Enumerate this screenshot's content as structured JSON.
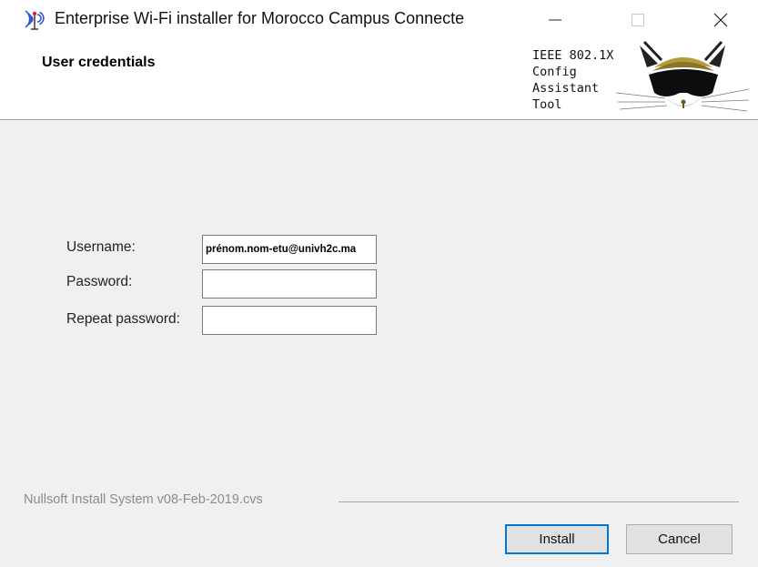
{
  "window": {
    "title": "Enterprise Wi-Fi installer for Morocco Campus Connecte",
    "controls": {
      "minimize": "minimize-icon",
      "maximize": "maximize-icon",
      "close": "close-icon"
    }
  },
  "header": {
    "title": "User credentials",
    "tool_lines": [
      "IEEE 802.1X",
      "Config",
      "Assistant",
      "Tool"
    ],
    "logo_icon": "cat-logo-icon"
  },
  "form": {
    "username": {
      "label": "Username:",
      "value": "prénom.nom-etu@univh2c.ma"
    },
    "password": {
      "label": "Password:",
      "value": ""
    },
    "repeat_password": {
      "label": "Repeat password:",
      "value": ""
    }
  },
  "footer": {
    "branding": "Nullsoft Install System v08-Feb-2019.cvs"
  },
  "buttons": {
    "install": "Install",
    "cancel": "Cancel"
  },
  "colors": {
    "content_bg": "#f0f0f0",
    "focus_border": "#0078d7",
    "button_bg": "#e1e1e1"
  }
}
